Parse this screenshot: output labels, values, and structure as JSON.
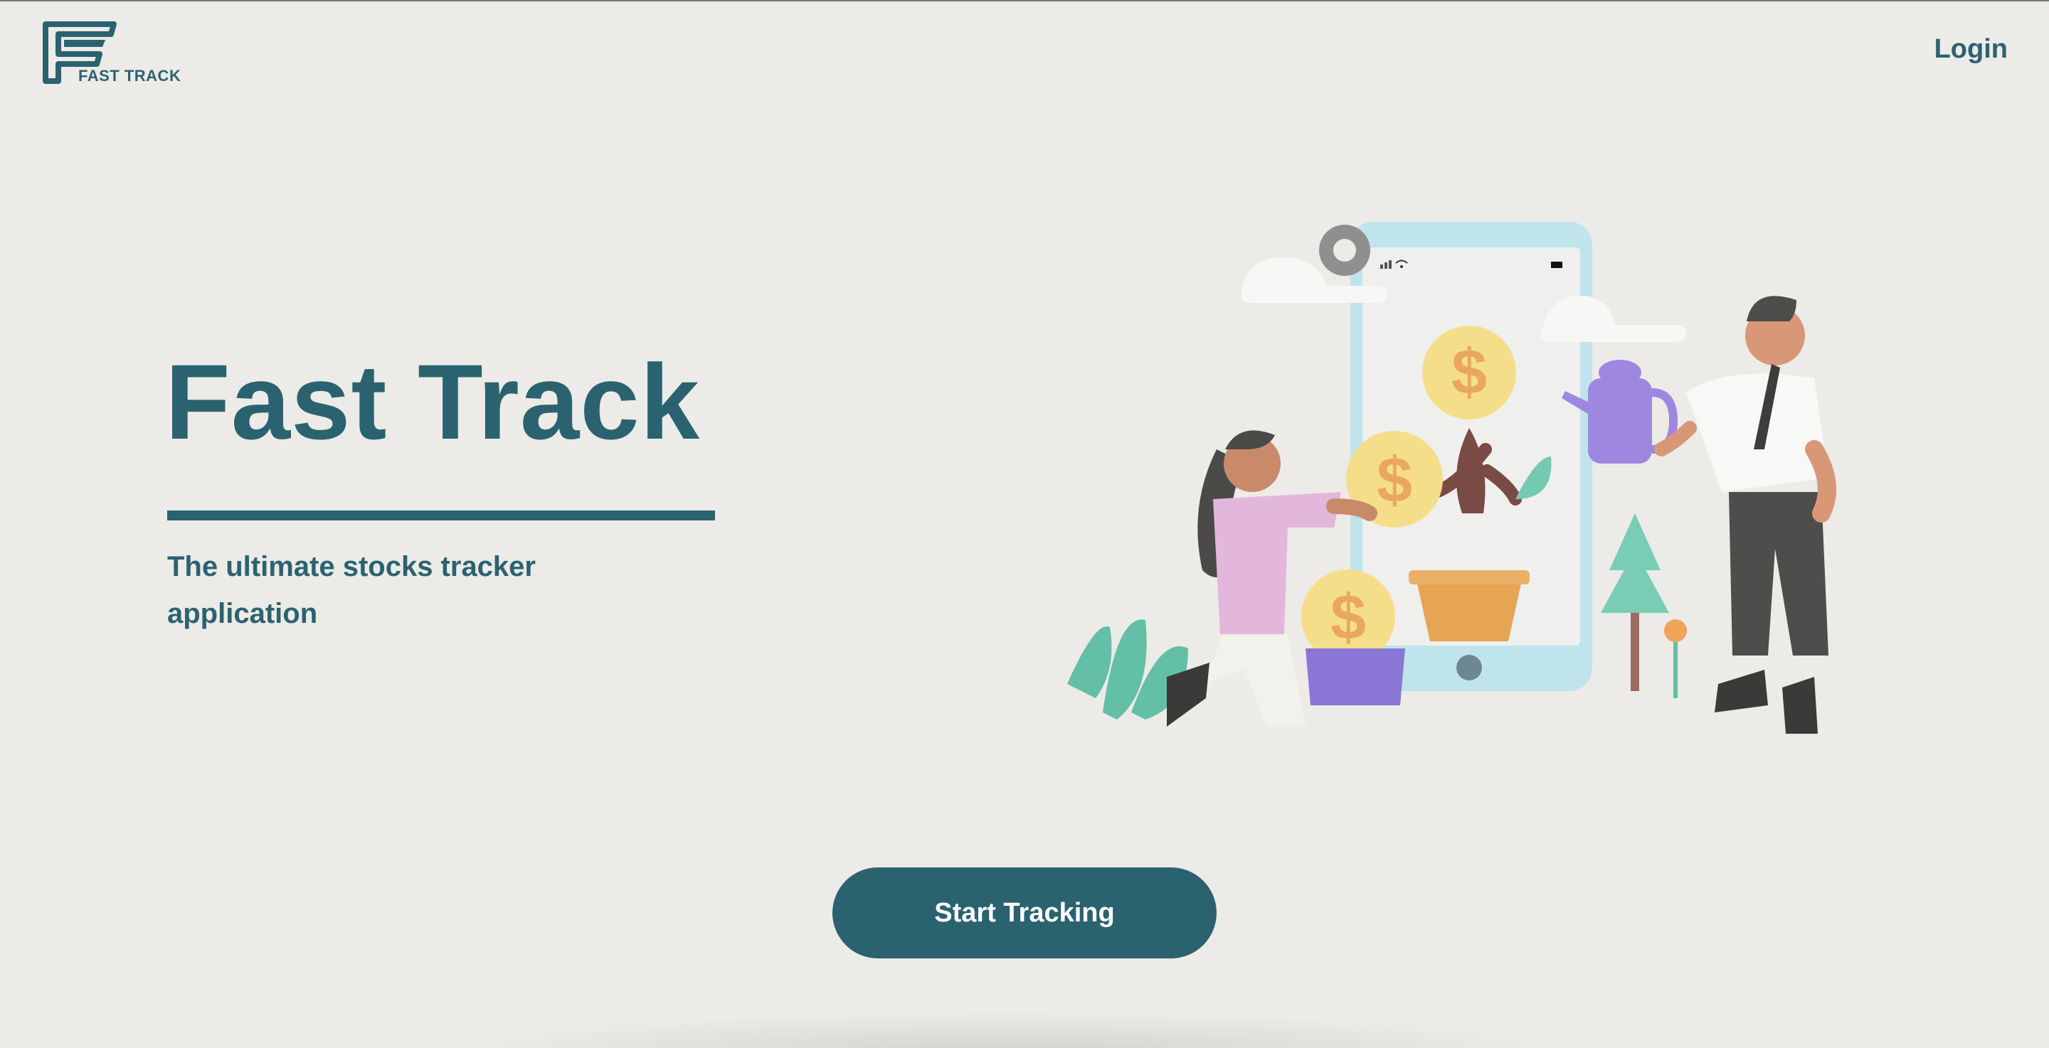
{
  "header": {
    "logo_text": "FAST TRACK",
    "login_label": "Login"
  },
  "hero": {
    "title": "Fast Track",
    "subtitle": "The ultimate stocks tracker application"
  },
  "cta": {
    "label": "Start Tracking"
  },
  "illustration": {
    "icons": [
      "gear-icon",
      "signal-icon",
      "wifi-icon",
      "battery-icon",
      "dollar-coin-icon",
      "watering-can-icon",
      "tree-icon",
      "plant-icon",
      "cloud-icon"
    ]
  },
  "colors": {
    "brand": "#2b6270",
    "background": "#ecebe7",
    "button_text": "#ffffff"
  }
}
